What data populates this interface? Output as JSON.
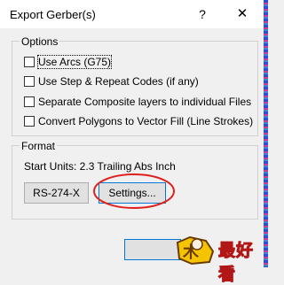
{
  "window": {
    "title": "Export Gerber(s)",
    "help_glyph": "?",
    "close_glyph": "✕"
  },
  "options": {
    "legend": "Options",
    "checkboxes": [
      {
        "label": "Use Arcs (G75)",
        "checked": false
      },
      {
        "label": "Use Step & Repeat Codes (if any)",
        "checked": false
      },
      {
        "label": "Separate Composite layers to individual Files",
        "checked": false
      },
      {
        "label": "Convert Polygons to Vector Fill (Line Strokes)",
        "checked": false
      }
    ]
  },
  "format": {
    "legend": "Format",
    "start_units": "Start Units: 2.3 Trailing Abs Inch",
    "rs274x_label": "RS-274-X",
    "settings_label": "Settings..."
  },
  "watermark": {
    "text": "最好看"
  },
  "colors": {
    "annotation": "#e0201c",
    "focus_border": "#0078d7"
  }
}
